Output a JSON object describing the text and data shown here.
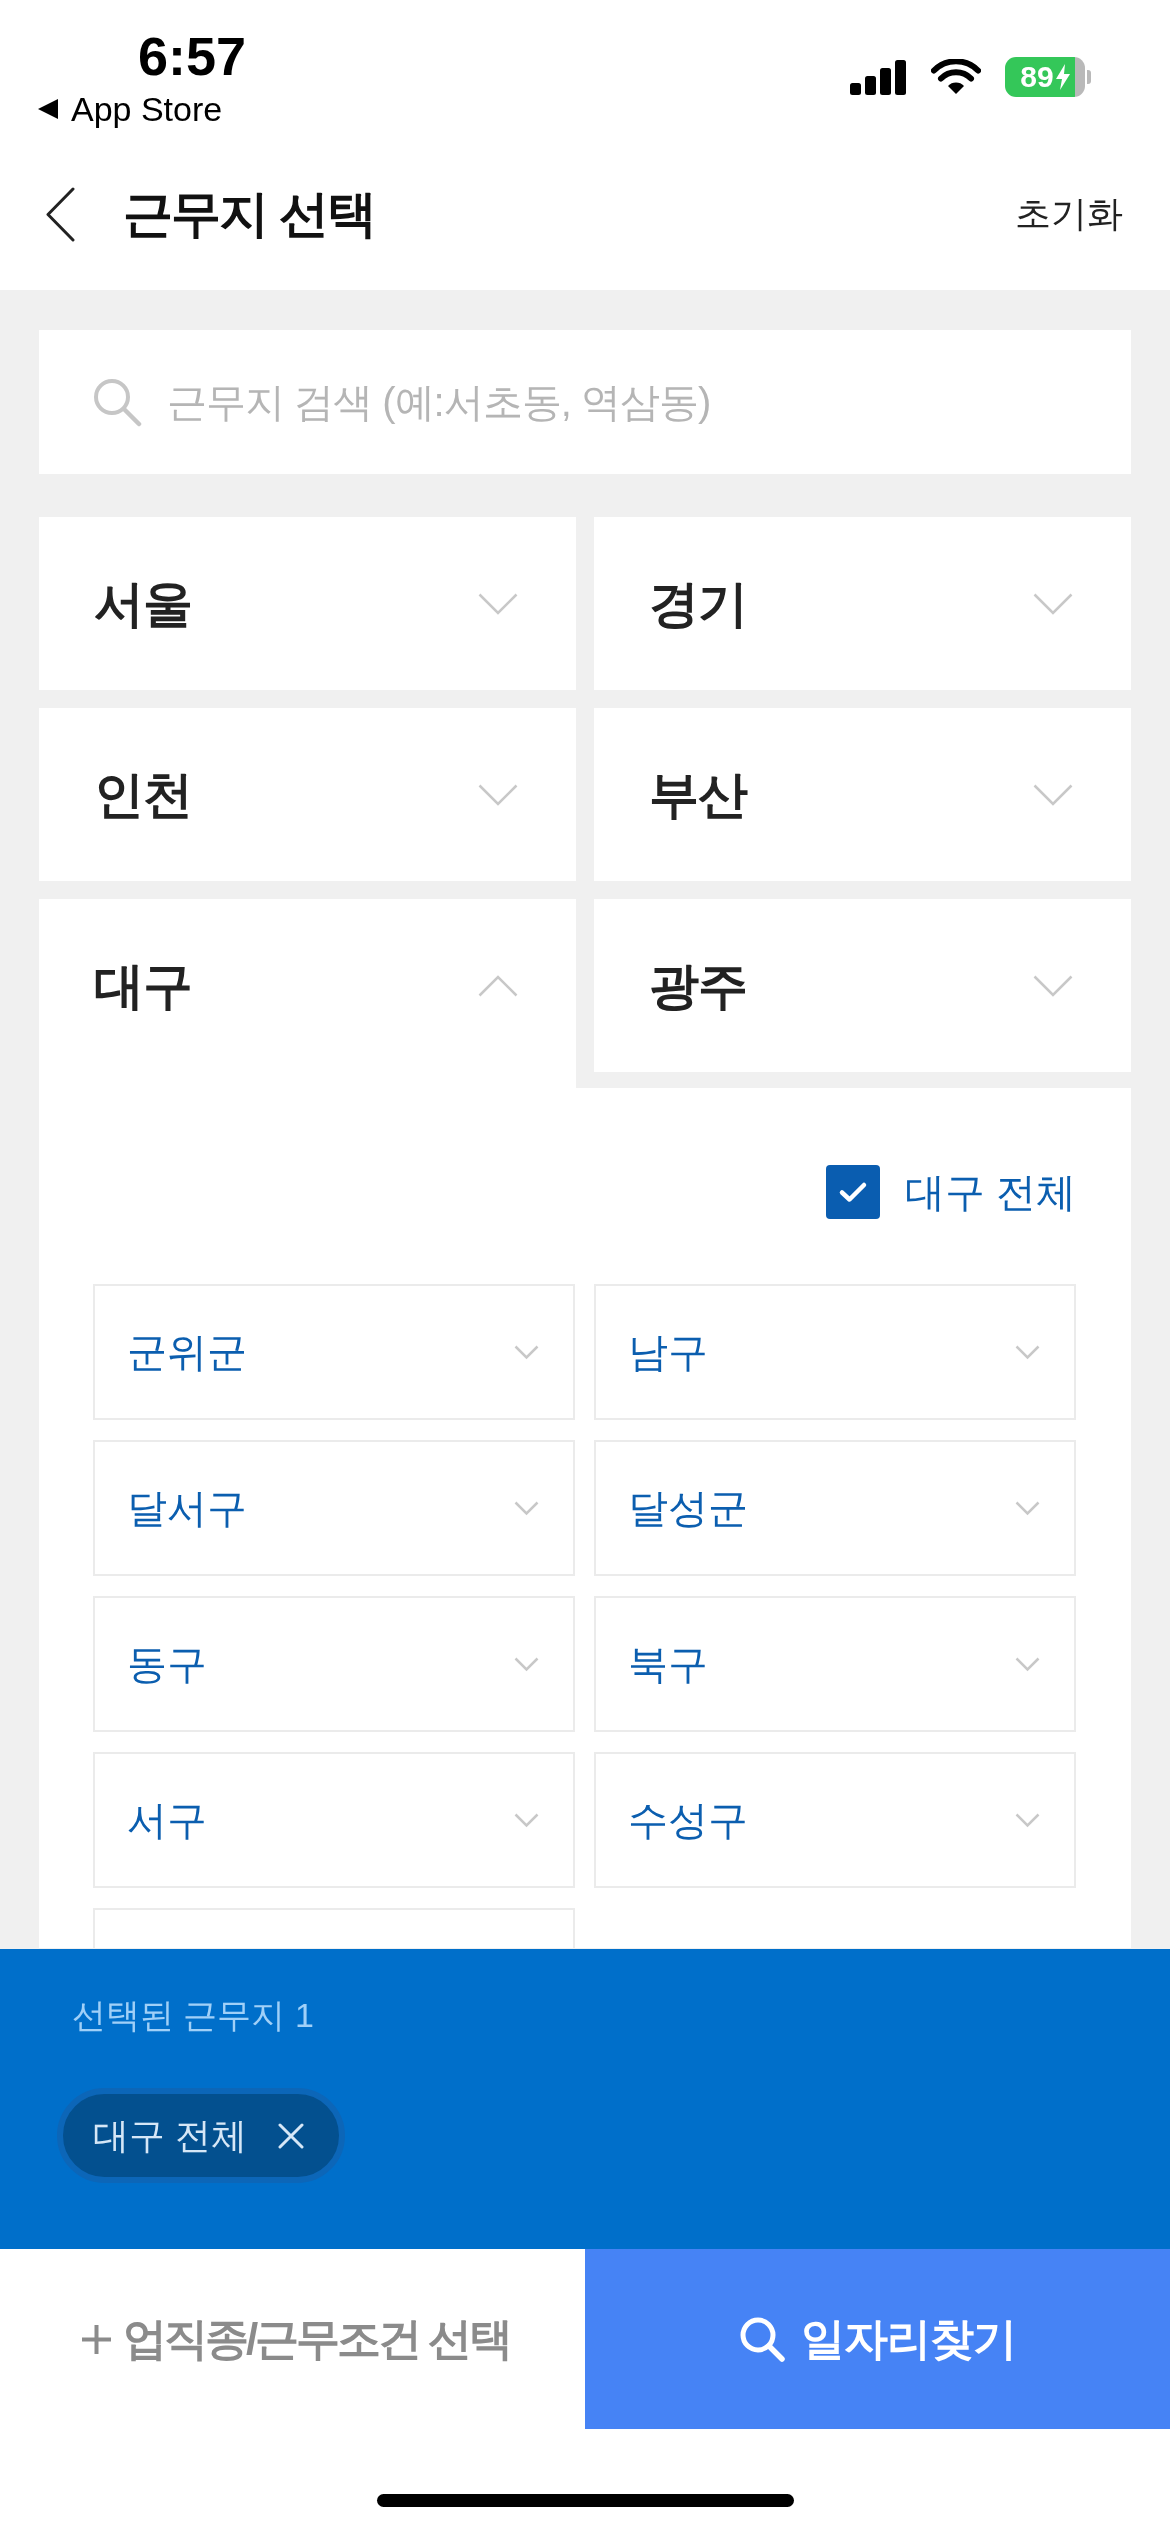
{
  "status_bar": {
    "time": "6:57",
    "back_label": "App Store",
    "battery": "89"
  },
  "header": {
    "title": "근무지 선택",
    "action": "초기화"
  },
  "search": {
    "placeholder": "근무지 검색 (예:서초동, 역삼동)"
  },
  "regions": [
    {
      "label": "서울",
      "expanded": false
    },
    {
      "label": "경기",
      "expanded": false
    },
    {
      "label": "인천",
      "expanded": false
    },
    {
      "label": "부산",
      "expanded": false
    },
    {
      "label": "대구",
      "expanded": true,
      "detail": {
        "select_all": {
          "label": "대구 전체",
          "checked": true
        },
        "districts": [
          {
            "kind": "district",
            "label": "군위군"
          },
          {
            "kind": "district",
            "label": "남구"
          },
          {
            "kind": "district",
            "label": "달서구"
          },
          {
            "kind": "district",
            "label": "달성군"
          },
          {
            "kind": "district",
            "label": "동구"
          },
          {
            "kind": "district",
            "label": "북구"
          },
          {
            "kind": "district",
            "label": "서구"
          },
          {
            "kind": "district",
            "label": "수성구"
          },
          {
            "kind": "clipped"
          }
        ]
      }
    },
    {
      "label": "광주",
      "expanded": false
    }
  ],
  "selection": {
    "title": "선택된 근무지 1",
    "chips": [
      {
        "label": "대구 전체"
      }
    ]
  },
  "bottom_bar": {
    "secondary": "업직종/근무조건 선택",
    "primary": "일자리찾기"
  }
}
